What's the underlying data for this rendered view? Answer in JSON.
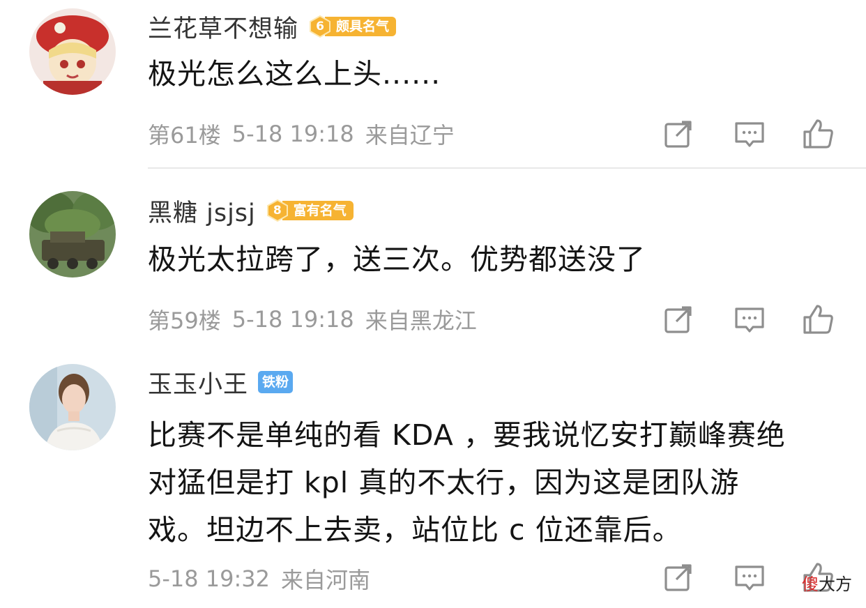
{
  "comments": [
    {
      "username": "兰花草不想输",
      "badge_level": "6",
      "badge_text": "颇具名气",
      "content_lines": [
        "极光怎么这么上头......"
      ],
      "floor": "第61楼",
      "time": "5-18 19:18",
      "location": "来自辽宁"
    },
    {
      "username": "黑糖 jsjsj",
      "badge_level": "8",
      "badge_text": "富有名气",
      "content_lines": [
        "极光太拉跨了，送三次。优势都送没了"
      ],
      "floor": "第59楼",
      "time": "5-18 19:18",
      "location": "来自黑龙江"
    },
    {
      "username": "玉玉小王",
      "fan_badge": "铁粉",
      "content_lines": [
        "比赛不是单纯的看 KDA ，要我说忆安打巅峰赛绝",
        "对猛但是打 kpl 真的不太行，因为这是团队游",
        "戏。坦边不上去卖，站位比 c 位还靠后。"
      ],
      "time": "5-18 19:32",
      "location": "来自河南"
    }
  ],
  "actions": {
    "share_icon": "share-icon",
    "reply_icon": "comment-icon",
    "like_icon": "thumbs-up-icon"
  },
  "watermark": {
    "accent": "傻",
    "rest": "大方"
  },
  "colors": {
    "badge_orange": "#f6b332",
    "fan_blue": "#5aa9f0",
    "meta_gray": "#9a9a9a"
  }
}
